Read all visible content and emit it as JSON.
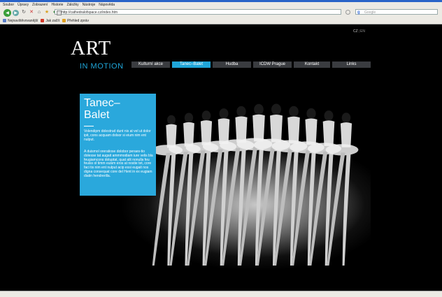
{
  "browser": {
    "menu": [
      "Soubor",
      "Úpravy",
      "Zobrazení",
      "Historie",
      "Záložky",
      "Nástroje",
      "Nápověda"
    ],
    "url": "http://cathedralofspace.cz/index.htm",
    "search_placeholder": "Google",
    "bookmarks": [
      {
        "label": "Nejnavštěvovanější",
        "color": "#5a7ec8"
      },
      {
        "label": "Jak začít",
        "color": "#d23a2a"
      },
      {
        "label": "Přehled zpráv",
        "color": "#e0a020"
      }
    ]
  },
  "site": {
    "lang": {
      "cz": "CZ",
      "sep": "|",
      "en": "EN"
    },
    "logo": {
      "art": "ART",
      "sub": "IN MOTION"
    },
    "nav": [
      {
        "label": "Kulturní akce",
        "active": false
      },
      {
        "label": "Tanec–Balet",
        "active": true
      },
      {
        "label": "Hudba",
        "active": false
      },
      {
        "label": "ICDW Prague",
        "active": false
      },
      {
        "label": "Kontakt",
        "active": false
      },
      {
        "label": "Links",
        "active": false
      }
    ],
    "card": {
      "title_line1": "Tanec–",
      "title_line2": "Balet",
      "p1": "Volendipm dolestrud dunt nis at vel ut dolor ipit, cons acquam dolsor si eium nim ent nulput.",
      "p2": "A duismol oreratiose dolobor peraes-tio dolesse tat augait ammmodiam iure velis bla feugiamcons doluptat, quat alit nonulla feu feuiss ol timm euism eros at nostie tet, core faci tis nim ent nulput acip essi eugait nos digna consequat core del Hent in ex eugiam diatin hendrerilla."
    },
    "colors": {
      "accent": "#1fa6d9",
      "nav_bg": "#3a3c40",
      "card_bg": "#2aa8dc"
    }
  }
}
